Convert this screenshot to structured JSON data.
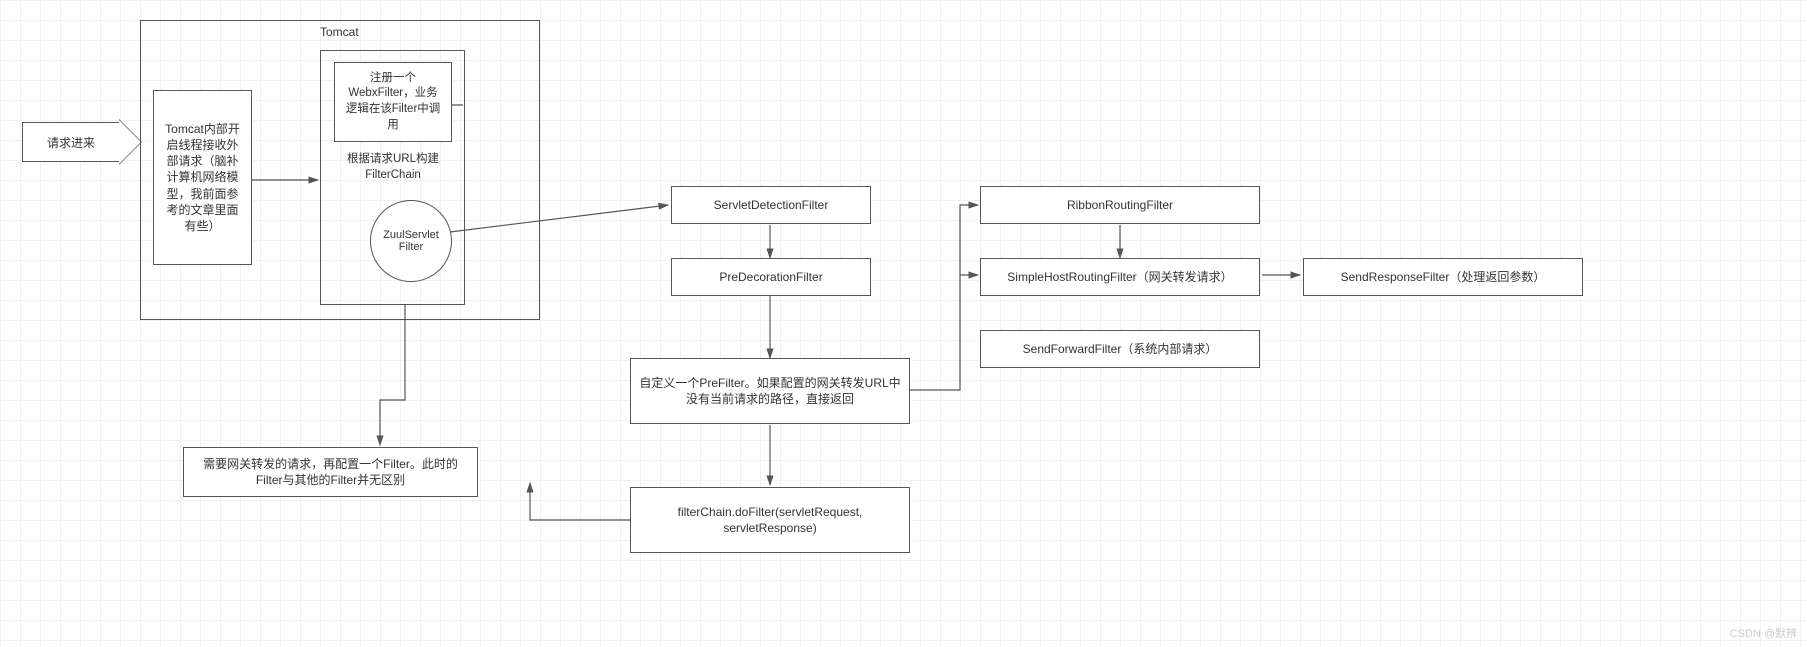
{
  "request_in": "请求进来",
  "tomcat_label": "Tomcat",
  "tomcat_desc": "Tomcat内部开启线程接收外部请求（脑补计算机网络模型，我前面参考的文章里面有些）",
  "webx_filter": "注册一个WebxFilter，业务逻辑在该Filter中调用",
  "filter_chain": "根据请求URL构建FilterChain",
  "zuul_servlet_filter": "ZuulServlet Filter",
  "gateway_note": "需要网关转发的请求，再配置一个Filter。此时的Filter与其他的Filter并无区别",
  "servlet_detection": "ServletDetectionFilter",
  "pre_decoration": "PreDecorationFilter",
  "custom_pre": "自定义一个PreFilter。如果配置的网关转发URL中没有当前请求的路径，直接返回",
  "do_filter": "filterChain.doFilter(servletRequest, servletResponse)",
  "ribbon_routing": "RibbonRoutingFilter",
  "simple_host": "SimpleHostRoutingFilter（网关转发请求）",
  "send_forward": "SendForwardFilter（系统内部请求）",
  "send_response": "SendResponseFilter（处理返回参数）",
  "watermark": "CSDN @默辨"
}
